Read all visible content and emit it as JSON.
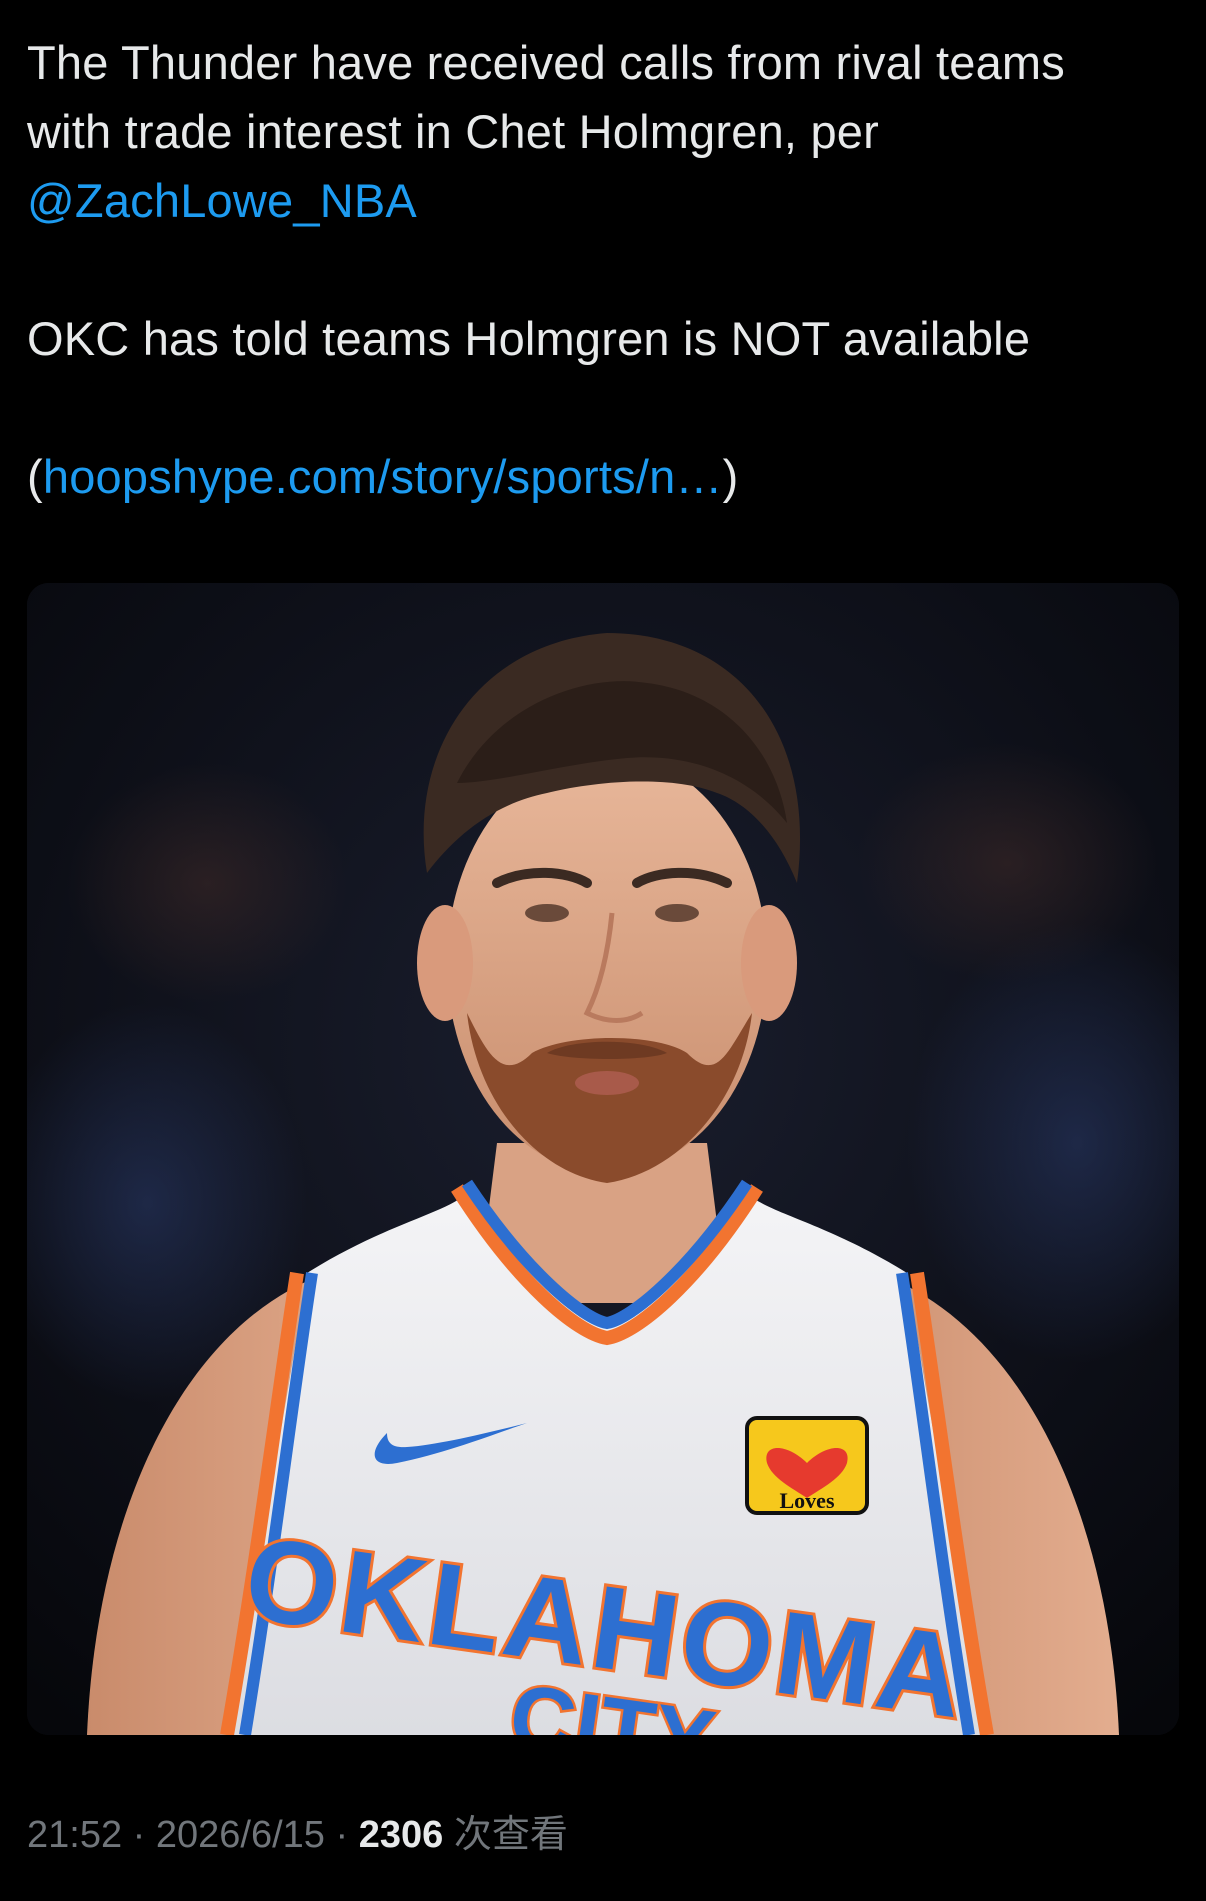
{
  "tweet": {
    "line1": "The Thunder have received calls from rival teams",
    "line2": "with trade interest in Chet Holmgren, per",
    "mention": "@ZachLowe_NBA",
    "line3": "OKC has told teams Holmgren is NOT available",
    "link_open": "(",
    "link_text": "hoopshype.com/story/sports/n…",
    "link_close": ")"
  },
  "media": {
    "jersey_text": "OKLAHOMA",
    "jersey_subtext": "CITY",
    "sponsor_patch": "Loves"
  },
  "meta": {
    "time": "21:52",
    "sep1": " · ",
    "date": "2026/6/15",
    "sep2": " · ",
    "views_count": "2306",
    "views_label": " 次查看"
  },
  "colors": {
    "background": "#000000",
    "text": "#e7e9ea",
    "link": "#1d9bf0",
    "muted": "#71767b"
  },
  "icons": {
    "nike_logo": "swoosh-icon",
    "sponsor": "loves-heart-icon"
  }
}
